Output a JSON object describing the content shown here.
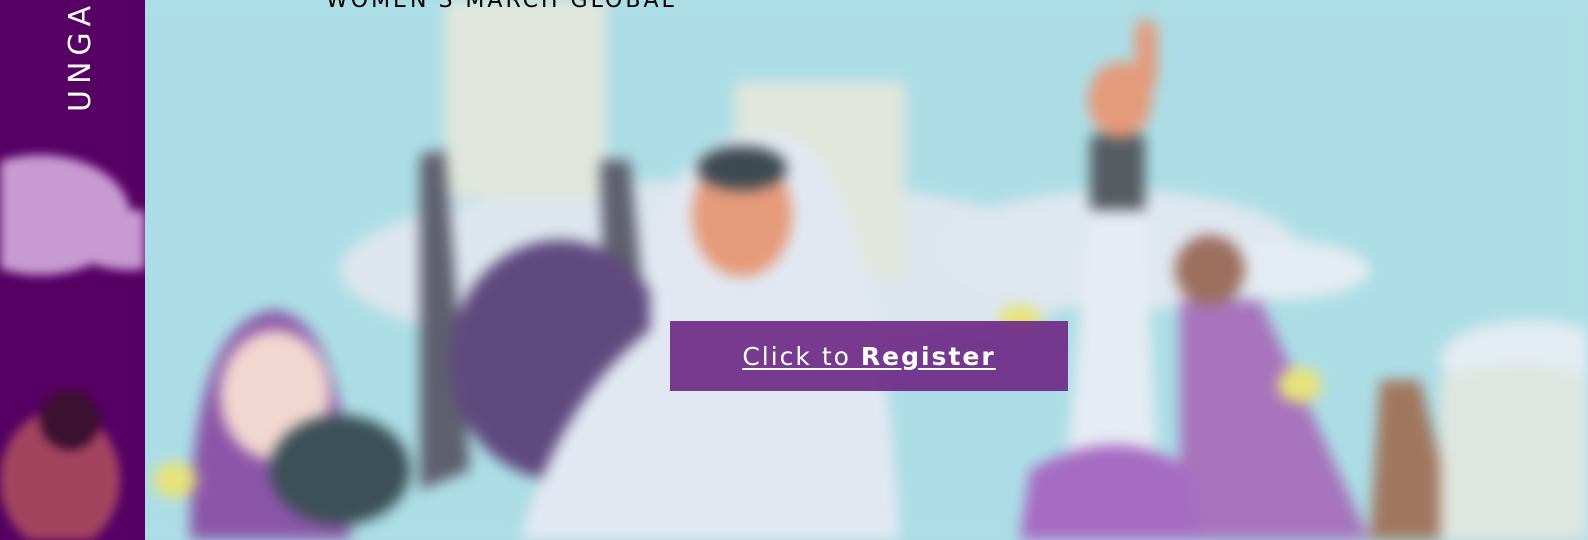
{
  "colors": {
    "sidebar_bg": "#560064",
    "sky": "#acdde6",
    "button_bg": "#6f2a87",
    "button_text": "#ffffff"
  },
  "sidebar": {
    "vertical_label": "UNGA"
  },
  "header": {
    "org_title": "WOMEN'S MARCH GLOBAL"
  },
  "hero": {
    "image_icon": "protest-crowd-illustration"
  },
  "cta": {
    "prefix": "Click to ",
    "emphasis": "Register"
  }
}
